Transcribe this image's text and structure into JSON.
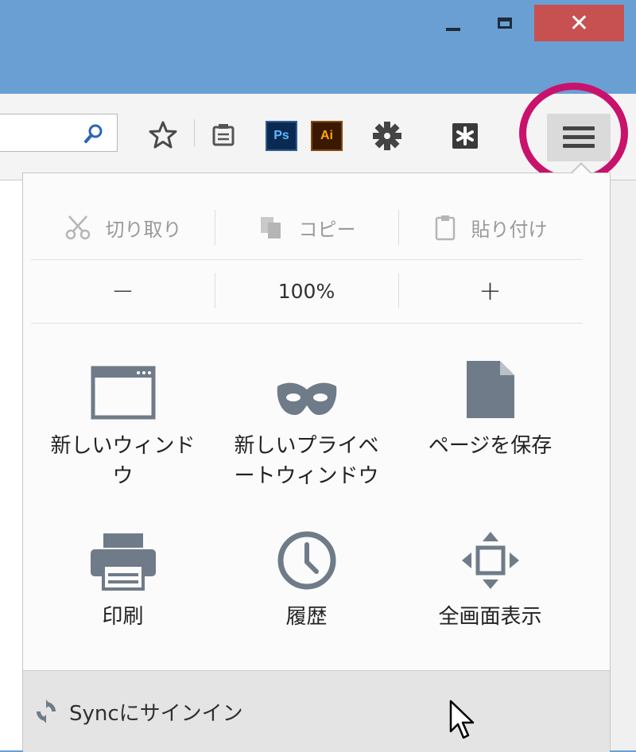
{
  "window": {
    "minimize_icon": "minimize-icon",
    "maximize_icon": "maximize-icon",
    "close_glyph": "✕",
    "close_color": "#c75050",
    "titlebar_color": "#6a9fd4"
  },
  "toolbar": {
    "search_icon": "search-icon",
    "bookmark_icon": "star-icon",
    "reader_icon": "reading-list-icon",
    "ps_label": "Ps",
    "ai_label": "Ai",
    "addon_icon": "puzzle-gear-icon",
    "extension_icon": "asterisk-icon",
    "menu_icon": "hamburger-menu-icon",
    "highlight_color": "#c8126c"
  },
  "menu": {
    "edit": {
      "cut": "切り取り",
      "copy": "コピー",
      "paste": "貼り付け"
    },
    "zoom": {
      "minus": "−",
      "level": "100%",
      "plus": "+"
    },
    "tiles": [
      {
        "label": "新しいウィンドウ",
        "icon": "window-icon"
      },
      {
        "label": "新しいプライベートウィンドウ",
        "icon": "mask-icon"
      },
      {
        "label": "ページを保存",
        "icon": "page-icon"
      },
      {
        "label": "印刷",
        "icon": "printer-icon"
      },
      {
        "label": "履歴",
        "icon": "clock-icon"
      },
      {
        "label": "全画面表示",
        "icon": "fullscreen-icon"
      }
    ],
    "footer": {
      "sync_label": "Syncにサインイン",
      "sync_icon": "sync-icon"
    }
  }
}
